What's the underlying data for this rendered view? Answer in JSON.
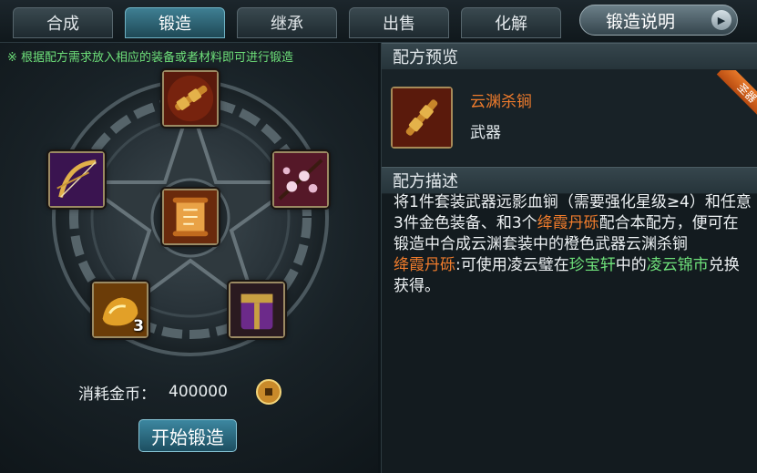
{
  "tabs": [
    {
      "label": "合成",
      "active": false
    },
    {
      "label": "锻造",
      "active": true
    },
    {
      "label": "继承",
      "active": false
    },
    {
      "label": "出售",
      "active": false
    },
    {
      "label": "化解",
      "active": false
    }
  ],
  "help_button": {
    "label": "锻造说明"
  },
  "hint": "※ 根据配方需求放入相应的装备或者材料即可进行锻造",
  "slots": [
    {
      "icon": "mace-weapon-icon",
      "count": ""
    },
    {
      "icon": "bow-weapon-icon",
      "count": ""
    },
    {
      "icon": "blossom-branch-icon",
      "count": ""
    },
    {
      "icon": "recipe-scroll-icon",
      "count": ""
    },
    {
      "icon": "gold-ore-icon",
      "count": "3"
    },
    {
      "icon": "purple-armor-icon",
      "count": ""
    }
  ],
  "cost": {
    "label": "消耗金币：",
    "value": "400000",
    "icon": "coin-icon"
  },
  "start_button": {
    "label": "开始锻造"
  },
  "preview": {
    "header": "配方预览",
    "item_name": "云渊杀锏",
    "item_type": "武器",
    "badge": "圣器",
    "item_icon": "mace-weapon-icon"
  },
  "description": {
    "header": "配方描述",
    "p1_a": "将1件套装武器远影血锏（需要强化星级≥4）和任意3件金色装备、和3个",
    "p1_b": "绛霞丹砾",
    "p1_c": "配合本配方，便可在锻造中合成云渊套装中的橙色武器云渊杀锏",
    "p2_a": "绛霞丹砾",
    "p2_b": ":可使用凌云璧在",
    "p2_c": "珍宝轩",
    "p2_d": "中的",
    "p2_e": "凌云锦市",
    "p2_f": "兑换获得。"
  },
  "colors": {
    "orange_text": "#f07c2c",
    "green_text": "#6ee07a",
    "active_tab": "#3f7f93"
  }
}
